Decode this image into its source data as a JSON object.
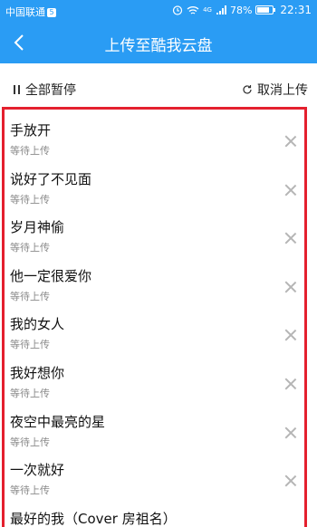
{
  "status_bar": {
    "carrier": "中国联通",
    "carrier_badge": "5",
    "signal_tag": "4G",
    "battery": "78%",
    "time": "22:31"
  },
  "nav": {
    "title": "上传至酷我云盘"
  },
  "toolbar": {
    "pause_all_label": "全部暂停",
    "cancel_upload_label": "取消上传"
  },
  "uploads": [
    {
      "name": "手放开",
      "status": "等待上传"
    },
    {
      "name": "说好了不见面",
      "status": "等待上传"
    },
    {
      "name": "岁月神偷",
      "status": "等待上传"
    },
    {
      "name": "他一定很爱你",
      "status": "等待上传"
    },
    {
      "name": "我的女人",
      "status": "等待上传"
    },
    {
      "name": "我好想你",
      "status": "等待上传"
    },
    {
      "name": "夜空中最亮的星",
      "status": "等待上传"
    },
    {
      "name": "一次就好",
      "status": "等待上传"
    },
    {
      "name": "最好的我（Cover 房祖名）",
      "status": ""
    }
  ],
  "colors": {
    "accent": "#2a9cf4",
    "highlight_border": "#e4202e"
  }
}
